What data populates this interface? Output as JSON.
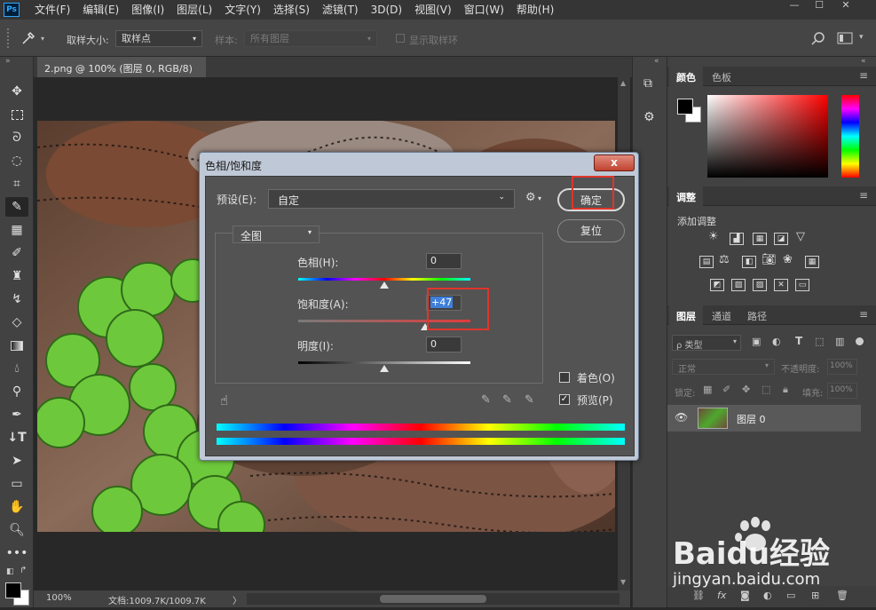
{
  "app": {
    "logo": "Ps"
  },
  "menubar": {
    "items": [
      "文件(F)",
      "编辑(E)",
      "图像(I)",
      "图层(L)",
      "文字(Y)",
      "选择(S)",
      "滤镜(T)",
      "3D(D)",
      "视图(V)",
      "窗口(W)",
      "帮助(H)"
    ]
  },
  "window_controls": {
    "minimize": "—",
    "maximize": "☐",
    "close": "✕"
  },
  "options": {
    "sample_size_label": "取样大小:",
    "sample_size_value": "取样点",
    "sample_label": "样本:",
    "sample_value": "所有图层",
    "show_ring_label": "显示取样环"
  },
  "document": {
    "tab_title": "2.png @ 100% (图层 0, RGB/8) *",
    "tab_close": "×"
  },
  "status": {
    "zoom": "100%",
    "doc_info": "文档:1009.7K/1009.7K",
    "arrow": "〉"
  },
  "panels": {
    "color_tabs": [
      "颜色",
      "色板"
    ],
    "adjust_tab": "调整",
    "add_adjust_label": "添加调整",
    "layers_tabs": [
      "图层",
      "通道",
      "路径"
    ],
    "filter_type": "ρ 类型",
    "blend_mode": "正常",
    "opacity_label": "不透明度:",
    "opacity_value": "100%",
    "lock_label": "锁定:",
    "fill_label": "填充:",
    "fill_value": "100%",
    "layer_name": "图层 0"
  },
  "dialog": {
    "title": "色相/饱和度",
    "close": "x",
    "preset_label": "预设(E):",
    "preset_value": "自定",
    "ok_button": "确定",
    "reset_button": "复位",
    "channel": "全图",
    "hue_label": "色相(H):",
    "hue_value": "0",
    "hue": 0,
    "saturation_label": "饱和度(A):",
    "saturation_value": "+47",
    "saturation": 47,
    "lightness_label": "明度(I):",
    "lightness_value": "0",
    "lightness": 0,
    "colorize_label": "着色(O)",
    "colorize_checked": false,
    "preview_label": "预览(P)",
    "preview_checked": true
  },
  "watermark": {
    "brand": "Baidu经验",
    "url": "jingyan.baidu.com"
  }
}
